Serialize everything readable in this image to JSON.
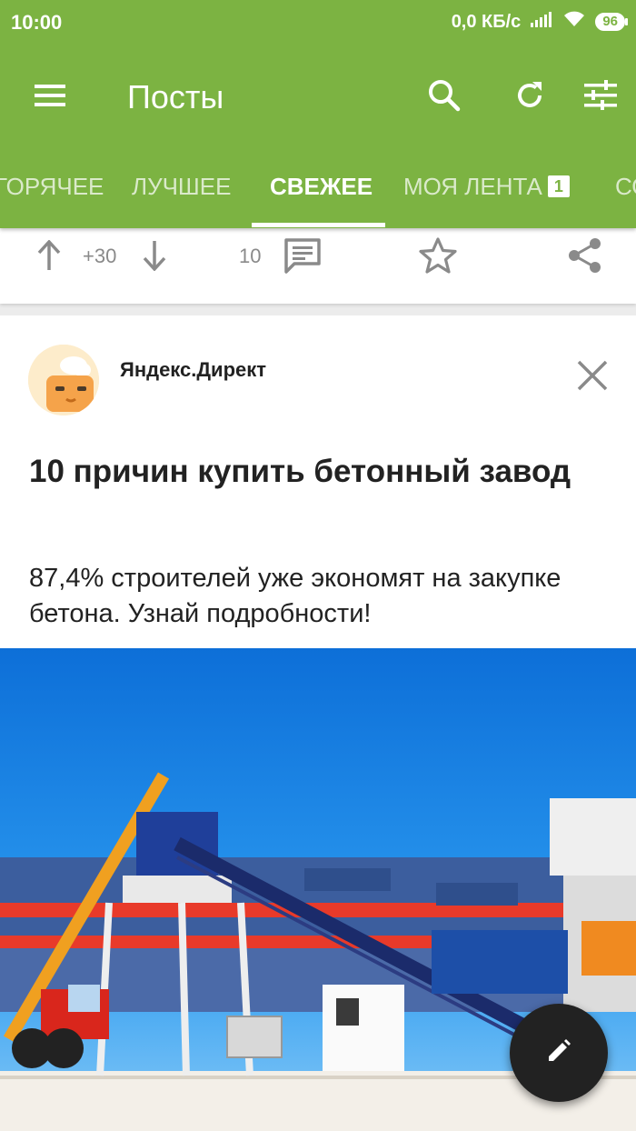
{
  "status_bar": {
    "time": "10:00",
    "network_speed": "0,0 КБ/с",
    "battery": "96",
    "icons": [
      "signal-icon",
      "wifi-icon",
      "battery-icon"
    ]
  },
  "toolbar": {
    "title": "Посты",
    "icons": [
      "menu-icon",
      "search-icon",
      "refresh-icon",
      "filter-icon"
    ]
  },
  "tabs": [
    {
      "label": "ГОРЯЧЕЕ"
    },
    {
      "label": "ЛУЧШЕЕ"
    },
    {
      "label": "СВЕЖЕЕ",
      "active": true
    },
    {
      "label": "МОЯ ЛЕНТА",
      "badge": "1"
    },
    {
      "label": "СО"
    }
  ],
  "post_actions": {
    "rating": "+30",
    "comments": "10",
    "icons": [
      "upvote-icon",
      "downvote-icon",
      "comment-icon",
      "star-icon",
      "share-icon"
    ]
  },
  "ad": {
    "source": "Яндекс.Директ",
    "title": "10 причин купить бетонный завод",
    "text": "87,4% строителей уже экономят на закупке бетона. Узнай подробности!"
  },
  "colors": {
    "primary": "#7cb342",
    "fab": "#222222",
    "icon_gray": "#8a8a8a"
  }
}
